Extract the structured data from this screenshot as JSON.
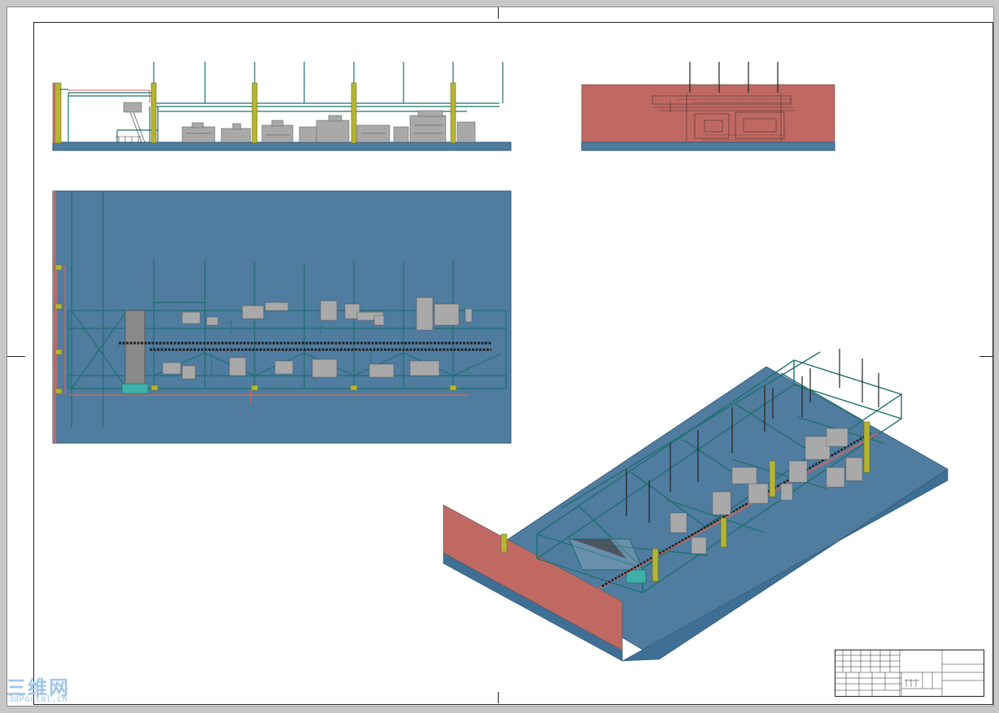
{
  "drawing": {
    "views": [
      "front-elevation",
      "side-elevation",
      "top-plan",
      "isometric"
    ]
  },
  "colors": {
    "sheet_background": "#ffffff",
    "viewer_background": "#c7c7c7",
    "floor_blue": "#4f7c9f",
    "floor_edge": "#3f6f95",
    "wall_red": "#c06963",
    "steel_green": "#1f6f6f",
    "column_yellow": "#b5b533",
    "equipment_gray": "#a9a9a9"
  },
  "title_block": {
    "cells": [
      "",
      "",
      "",
      "",
      "",
      "",
      "",
      "",
      "",
      "",
      "",
      ""
    ]
  },
  "watermark": {
    "logo_text": "三维网",
    "site": "3dPortal.cn"
  }
}
